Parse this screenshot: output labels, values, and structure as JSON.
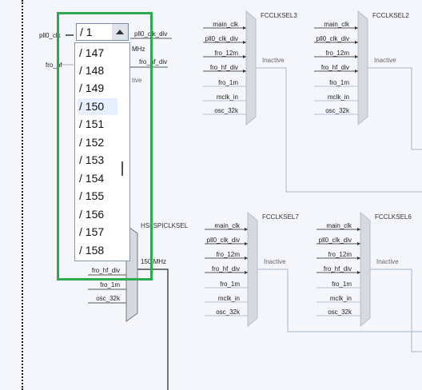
{
  "diagram": {
    "left_inputs": {
      "pll0_clk": "pll0_clk",
      "fro_hf": "fro_hf"
    },
    "partial_labels": {
      "pll0_clk_div": "pll0_clk_div",
      "mhz_1": "MHz",
      "fro_hf_div": "fro_hf_div",
      "inactive_partial": "tive"
    },
    "muxes": [
      {
        "title": "FCCLKSEL3",
        "inputs": [
          "main_clk",
          "pll0_clk_div",
          "fro_12m",
          "fro_hf_div",
          "fro_1m",
          "mclk_in",
          "osc_32k"
        ],
        "status": "Inactive"
      },
      {
        "title": "FCCLKSEL2",
        "inputs": [
          "main_clk",
          "pll0_clk_div",
          "fro_12m",
          "fro_hf_div",
          "fro_1m",
          "mclk_in",
          "osc_32k"
        ],
        "status": "Inactive"
      },
      {
        "title": "FCCLKSEL7",
        "inputs": [
          "main_clk",
          "pll0_clk_div",
          "fro_12m",
          "fro_hf_div",
          "fro_1m",
          "mclk_in",
          "osc_32k"
        ],
        "status": "Inactive"
      },
      {
        "title": "FCCLKSEL6",
        "inputs": [
          "main_clk",
          "pll0_clk_div",
          "fro_12m",
          "fro_hf_div",
          "fro_1m",
          "mclk_in",
          "osc_32k"
        ],
        "status": "Inactive"
      }
    ],
    "hs_mux": {
      "title": "HSLSPICLKSEL",
      "output_freq": "150 MHz",
      "visible_inputs": [
        "fro_hf_div",
        "fro_1m",
        "osc_32k"
      ]
    }
  },
  "divider_dropdown": {
    "selected": "/ 1",
    "options": [
      "/ 147",
      "/ 148",
      "/ 149",
      "/ 150",
      "/ 151",
      "/ 152",
      "/ 153",
      "/ 154",
      "/ 155",
      "/ 156",
      "/ 157",
      "/ 158"
    ],
    "highlighted_option": "/ 150"
  },
  "colors": {
    "highlight_frame": "#2fa84f",
    "mux_fill": "#d5d9e0",
    "wire": "#a8b4cc",
    "wire_dark": "#4a4a4a"
  }
}
